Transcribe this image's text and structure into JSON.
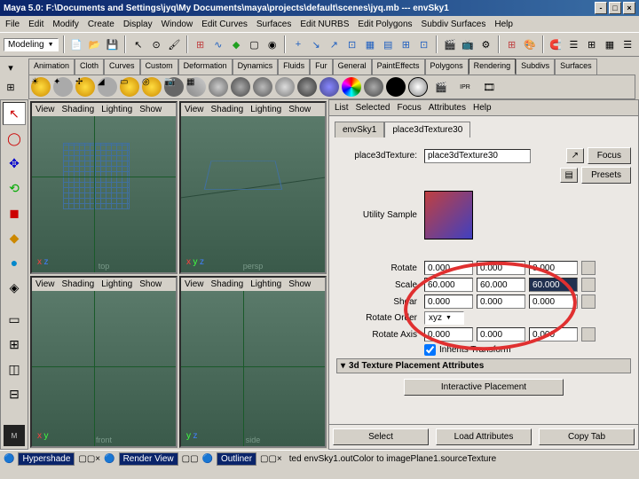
{
  "title": "Maya 5.0: F:\\Documents and Settings\\jyq\\My Documents\\maya\\projects\\default\\scenes\\jyq.mb --- envSky1",
  "menus": [
    "File",
    "Edit",
    "Modify",
    "Create",
    "Display",
    "Window",
    "Edit Curves",
    "Surfaces",
    "Edit NURBS",
    "Edit Polygons",
    "Subdiv Surfaces",
    "Help"
  ],
  "mode": "Modeling",
  "shelf_tabs": [
    "Animation",
    "Cloth",
    "Curves",
    "Custom",
    "Deformation",
    "Dynamics",
    "Fluids",
    "Fur",
    "General",
    "PaintEffects",
    "Polygons",
    "Rendering",
    "Subdivs",
    "Surfaces"
  ],
  "active_shelf": "Rendering",
  "vp_menus": [
    "View",
    "Shading",
    "Lighting",
    "Show"
  ],
  "vp_labels": {
    "tl": "top",
    "tr": "persp",
    "bl": "front",
    "br": "side"
  },
  "attr": {
    "menus": [
      "List",
      "Selected",
      "Focus",
      "Attributes",
      "Help"
    ],
    "tabs": [
      "envSky1",
      "place3dTexture30"
    ],
    "active_tab": "place3dTexture30",
    "node_label": "place3dTexture:",
    "node_name": "place3dTexture30",
    "util_label": "Utility Sample",
    "focus_btn": "Focus",
    "presets_btn": "Presets",
    "fields": {
      "rotate": {
        "label": "Rotate",
        "x": "0.000",
        "y": "0.000",
        "z": "0.000"
      },
      "scale": {
        "label": "Scale",
        "x": "60.000",
        "y": "60.000",
        "z": "60.000"
      },
      "shear": {
        "label": "Shear",
        "x": "0.000",
        "y": "0.000",
        "z": "0.000"
      },
      "rotate_order": {
        "label": "Rotate Order",
        "value": "xyz"
      },
      "rotate_axis": {
        "label": "Rotate Axis",
        "x": "0.000",
        "y": "0.000",
        "z": "0.000"
      },
      "inherits": "Inherits Transform"
    },
    "section": "3d Texture Placement Attributes",
    "interactive_btn": "Interactive Placement",
    "bottom": {
      "select": "Select",
      "load": "Load Attributes",
      "copy": "Copy Tab"
    }
  },
  "status": {
    "items": [
      "Hypershade",
      "Render View",
      "Outliner"
    ],
    "msg": "ted envSky1.outColor to imagePlane1.sourceTexture"
  },
  "icons": {
    "arrow": "↖",
    "circle": "○",
    "drop": "💧",
    "ball": "●",
    "cube": "◼",
    "ball2": "⬤",
    "sphere": "⚫"
  }
}
